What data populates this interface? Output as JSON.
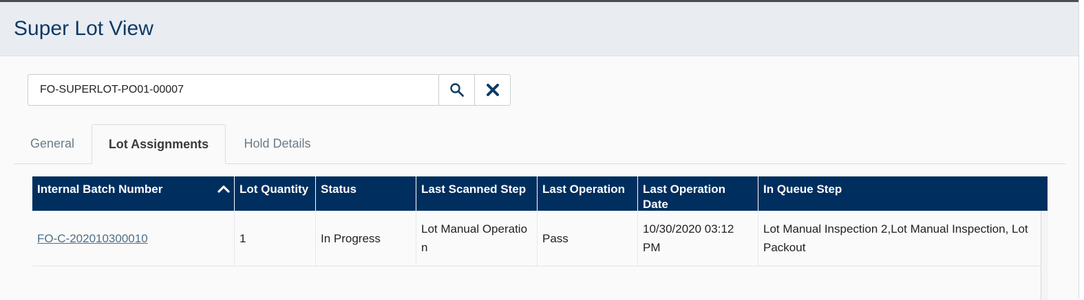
{
  "page": {
    "title": "Super Lot View"
  },
  "search": {
    "value": "FO-SUPERLOT-PO01-00007"
  },
  "icons": {
    "search": "search-icon",
    "clear": "close-icon",
    "sort": "chevron-up-icon"
  },
  "tabs": [
    {
      "label": "General",
      "active": false
    },
    {
      "label": "Lot Assignments",
      "active": true
    },
    {
      "label": "Hold Details",
      "active": false
    }
  ],
  "table": {
    "columns": [
      "Internal Batch Number",
      "Lot Quantity",
      "Status",
      "Last Scanned Step",
      "Last Operation",
      "Last Operation Date",
      "In Queue Step"
    ],
    "rows": [
      {
        "internal_batch_number": "FO-C-202010300010",
        "lot_quantity": "1",
        "status": "In Progress",
        "last_scanned_step": "Lot Manual Operation",
        "last_operation": "Pass",
        "last_operation_date": "10/30/2020 03:12 PM",
        "in_queue_step": "Lot Manual Inspection 2,Lot Manual Inspection, Lot Packout"
      }
    ]
  },
  "colors": {
    "header_bg": "#002e5e",
    "title": "#0e3a66",
    "link": "#4f6e86"
  }
}
